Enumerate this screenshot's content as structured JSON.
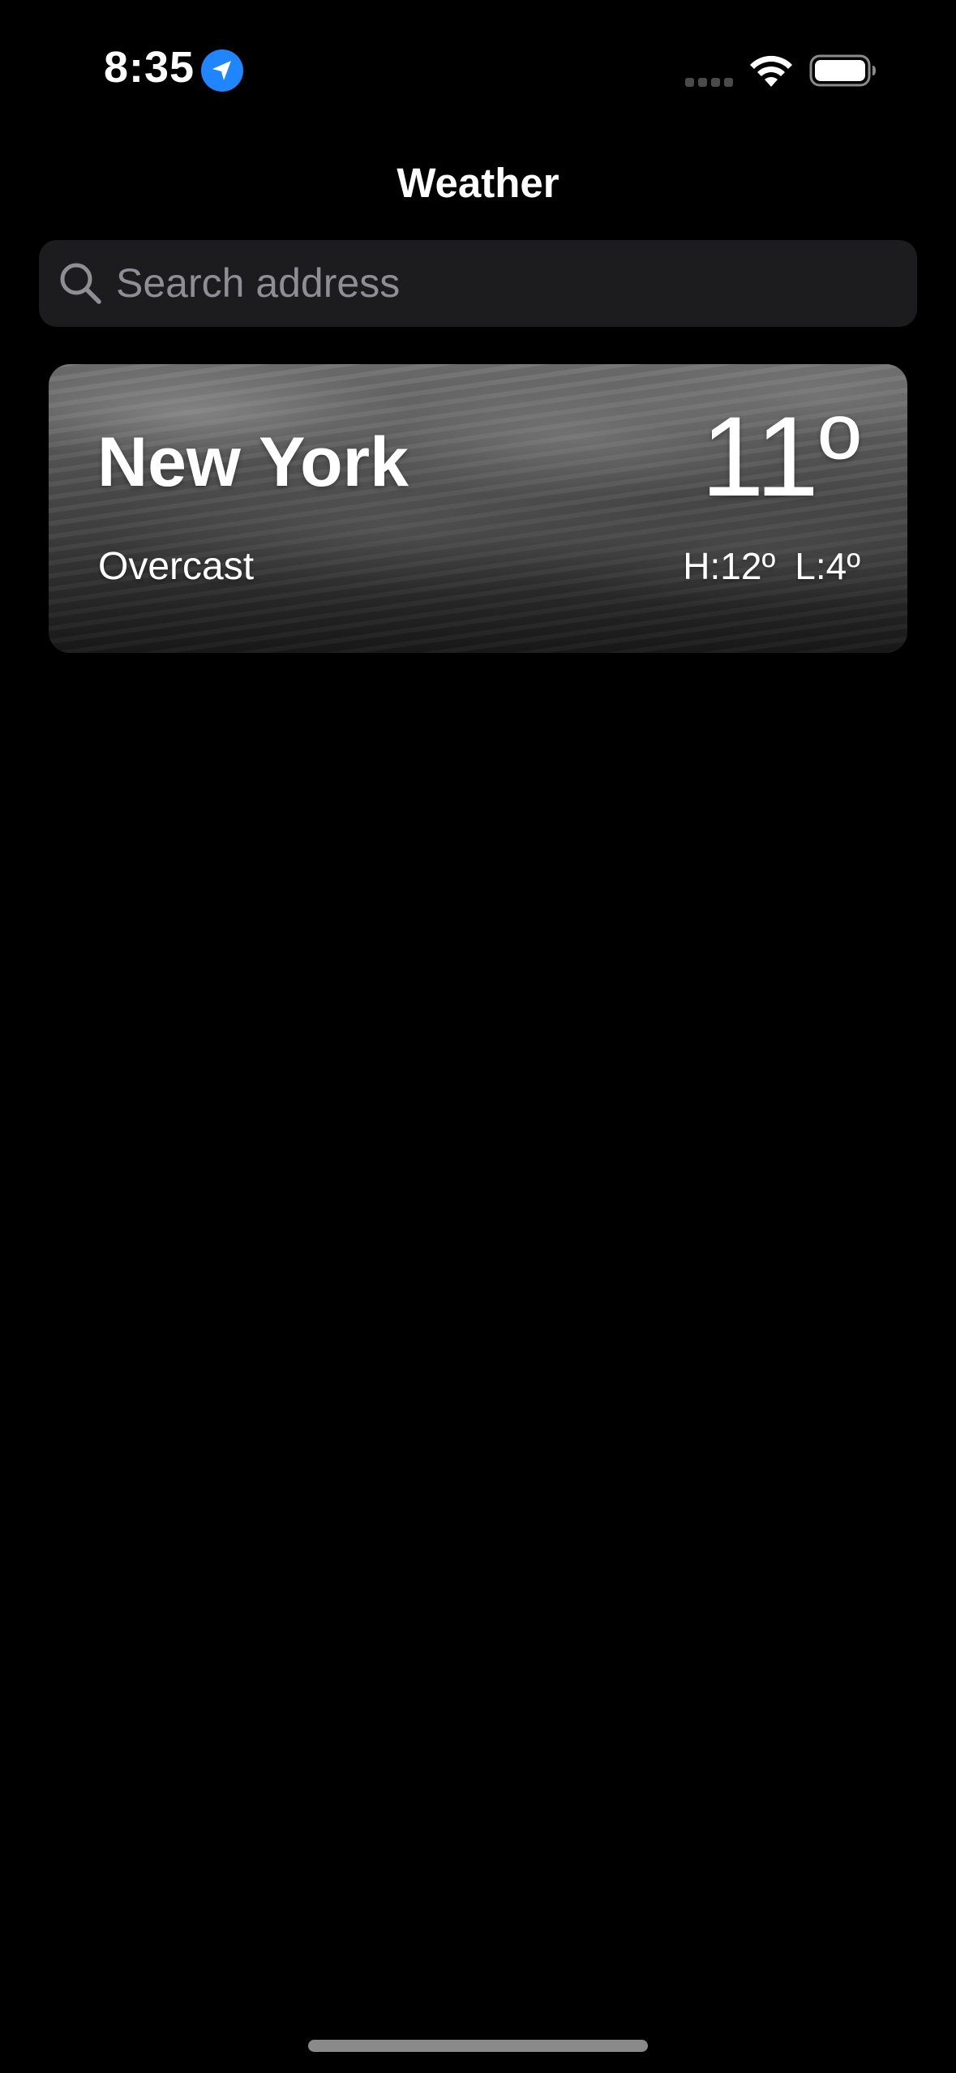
{
  "status_bar": {
    "time": "8:35",
    "location_icon": "location-arrow-icon",
    "accent_color": "#1f86ff",
    "signal_icon": "cellular-signal-icon",
    "wifi_icon": "wifi-icon",
    "battery_icon": "battery-icon"
  },
  "nav": {
    "title": "Weather"
  },
  "search": {
    "placeholder": "Search address",
    "value": "",
    "icon": "search-icon"
  },
  "locations": [
    {
      "city": "New York",
      "condition": "Overcast",
      "temperature": "11º",
      "high": "H:12º",
      "low": "L:4º",
      "background": "overcast-clouds"
    }
  ]
}
